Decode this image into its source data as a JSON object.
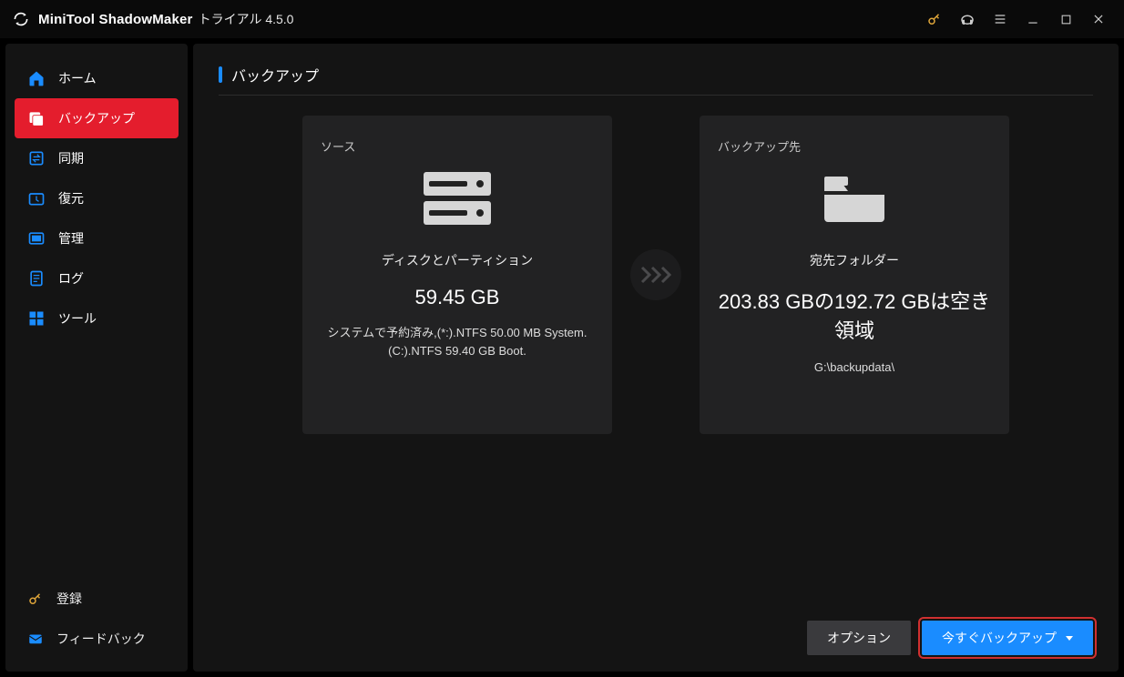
{
  "titlebar": {
    "brand": "MiniTool ShadowMaker",
    "edition": "トライアル 4.5.0"
  },
  "sidebar": {
    "items": [
      {
        "label": "ホーム",
        "icon": "home-icon"
      },
      {
        "label": "バックアップ",
        "icon": "backup-icon",
        "active": true
      },
      {
        "label": "同期",
        "icon": "sync-icon"
      },
      {
        "label": "復元",
        "icon": "restore-icon"
      },
      {
        "label": "管理",
        "icon": "manage-icon"
      },
      {
        "label": "ログ",
        "icon": "log-icon"
      },
      {
        "label": "ツール",
        "icon": "tools-icon"
      }
    ],
    "bottom": [
      {
        "label": "登録",
        "icon": "register-key-icon"
      },
      {
        "label": "フィードバック",
        "icon": "feedback-mail-icon"
      }
    ]
  },
  "page": {
    "title": "バックアップ",
    "source_card": {
      "caption": "ソース",
      "type": "ディスクとパーティション",
      "size": "59.45 GB",
      "detail": "システムで予約済み,(*:).NTFS 50.00 MB System.\n(C:).NTFS 59.40 GB Boot."
    },
    "dest_card": {
      "caption": "バックアップ先",
      "type": "宛先フォルダー",
      "size": "203.83 GBの192.72 GBは空き領域",
      "detail": "G:\\backupdata\\"
    },
    "footer": {
      "options_label": "オプション",
      "backup_now_label": "今すぐバックアップ"
    }
  }
}
